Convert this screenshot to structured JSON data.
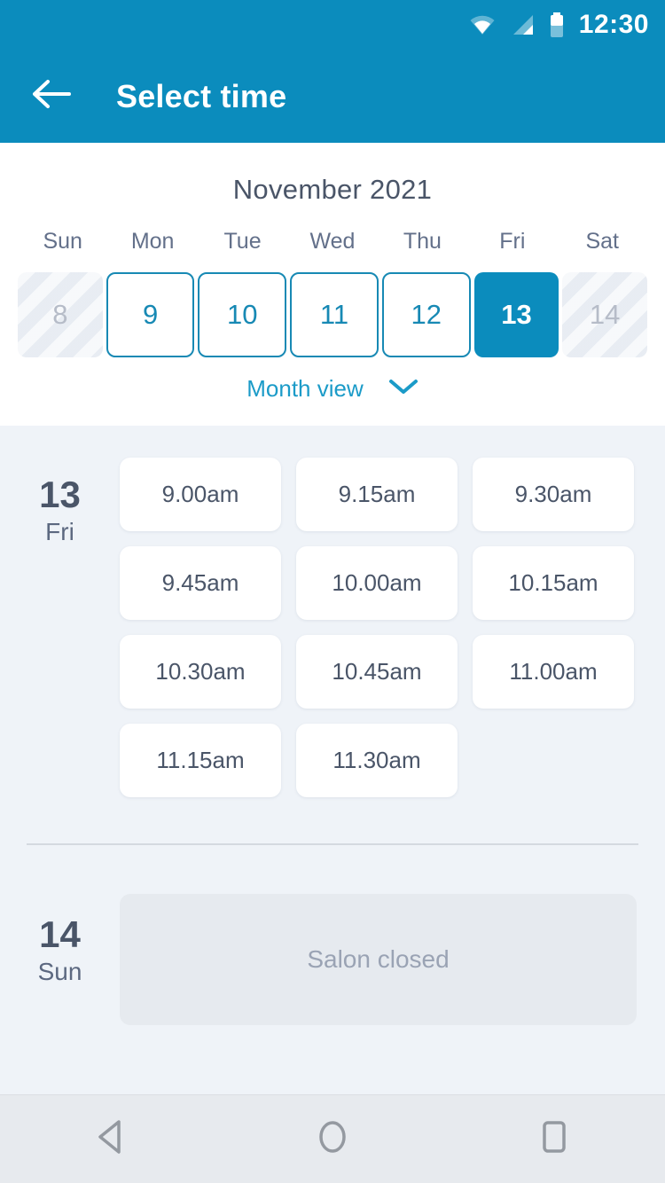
{
  "status_bar": {
    "time": "12:30",
    "icons": [
      "wifi-icon",
      "signal-icon",
      "battery-icon"
    ]
  },
  "app_bar": {
    "back_icon": "back-arrow-icon",
    "title": "Select time"
  },
  "calendar": {
    "month_title": "November 2021",
    "weekdays": [
      "Sun",
      "Mon",
      "Tue",
      "Wed",
      "Thu",
      "Fri",
      "Sat"
    ],
    "days": [
      {
        "number": "8",
        "state": "disabled"
      },
      {
        "number": "9",
        "state": "available"
      },
      {
        "number": "10",
        "state": "available"
      },
      {
        "number": "11",
        "state": "available"
      },
      {
        "number": "12",
        "state": "available"
      },
      {
        "number": "13",
        "state": "selected"
      },
      {
        "number": "14",
        "state": "disabled"
      }
    ],
    "month_view_label": "Month view",
    "month_view_icon": "chevron-down-icon"
  },
  "schedule": [
    {
      "day_number": "13",
      "day_name": "Fri",
      "slots": [
        "9.00am",
        "9.15am",
        "9.30am",
        "9.45am",
        "10.00am",
        "10.15am",
        "10.30am",
        "10.45am",
        "11.00am",
        "11.15am",
        "11.30am"
      ],
      "closed_message": null
    },
    {
      "day_number": "14",
      "day_name": "Sun",
      "slots": [],
      "closed_message": "Salon closed"
    }
  ],
  "nav_bar": {
    "buttons": [
      "back-triangle-icon",
      "home-circle-icon",
      "recents-square-icon"
    ]
  },
  "colors": {
    "brand": "#0b8cbd",
    "accent": "#1789b4",
    "page_bg": "#eff3f8",
    "card_bg": "#ffffff",
    "text_dark": "#4a5568",
    "text_muted": "#9aa3b4"
  }
}
